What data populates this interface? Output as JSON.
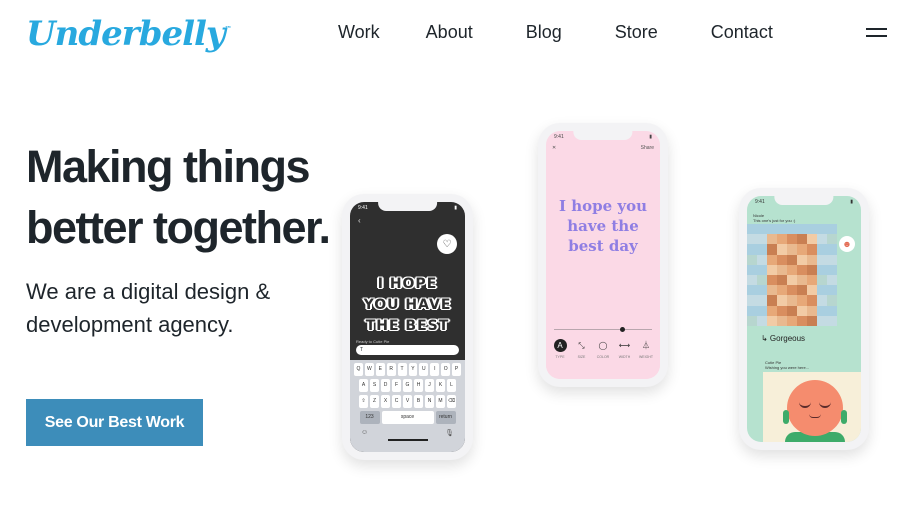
{
  "header": {
    "logo_text": "Underbelly",
    "logo_tm": "™",
    "nav": [
      "Work",
      "About",
      "Blog",
      "Store",
      "Contact"
    ],
    "menu_icon": "hamburger-icon"
  },
  "hero": {
    "title_line1": "Making things",
    "title_line2": "better together.",
    "subtitle": "We are a digital design & development agency.",
    "cta_label": "See Our Best Work"
  },
  "phone1": {
    "time": "9:41",
    "message_lines": [
      "I HOPE",
      "YOU HAVE",
      "THE BEST"
    ],
    "ready_label": "Ready to Cutie Pie",
    "field_value": "T",
    "keys_row1": [
      "Q",
      "W",
      "E",
      "R",
      "T",
      "Y",
      "U",
      "I",
      "O",
      "P"
    ],
    "keys_row2": [
      "A",
      "S",
      "D",
      "F",
      "G",
      "H",
      "J",
      "K",
      "L"
    ],
    "keys_row3": [
      "Z",
      "X",
      "C",
      "V",
      "B",
      "N",
      "M"
    ],
    "key_123": "123",
    "key_space": "space",
    "key_return": "return"
  },
  "phone2": {
    "time": "9:41",
    "close": "✕",
    "share": "Share",
    "message_lines": [
      "I hope you",
      "have the",
      "best day"
    ],
    "tools": [
      {
        "glyph": "A",
        "label": "TYPE"
      },
      {
        "glyph": "⤡",
        "label": "SIZE"
      },
      {
        "glyph": "◯",
        "label": "COLOR"
      },
      {
        "glyph": "⟷",
        "label": "WIDTH"
      },
      {
        "glyph": "⏃",
        "label": "WEIGHT"
      }
    ]
  },
  "phone3": {
    "time": "9:41",
    "sender": "Nicole",
    "sender_note": "This one's just for you :)",
    "reply": "↳ Gorgeous",
    "sender2": "Cutie Pie",
    "sender2_note": "Wishing you were here..."
  }
}
